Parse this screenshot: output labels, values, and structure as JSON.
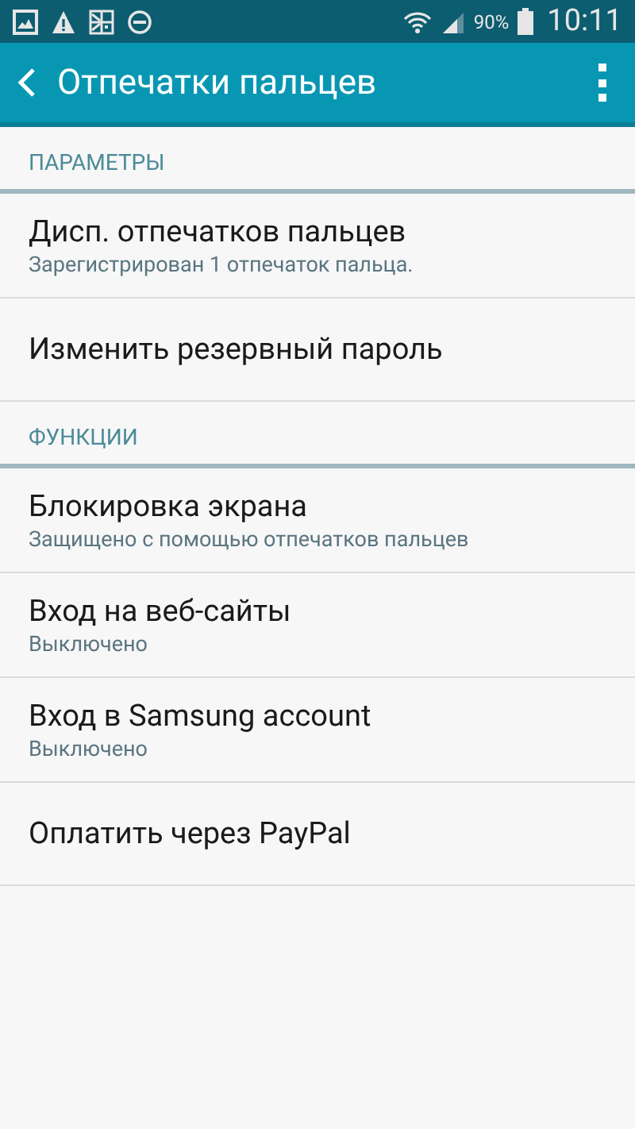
{
  "status_bar": {
    "battery_text": "90%",
    "time": "10:11"
  },
  "app_bar": {
    "title": "Отпечатки пальцев"
  },
  "sections": [
    {
      "header": "ПАРАМЕТРЫ",
      "items": [
        {
          "title": "Дисп. отпечатков пальцев",
          "subtitle": "Зарегистрирован 1 отпечаток пальца."
        },
        {
          "title": "Изменить резервный пароль"
        }
      ]
    },
    {
      "header": "ФУНКЦИИ",
      "items": [
        {
          "title": "Блокировка экрана",
          "subtitle": "Защищено с помощью отпечатков пальцев"
        },
        {
          "title": "Вход на веб-сайты",
          "subtitle": "Выключено"
        },
        {
          "title": "Вход в Samsung account",
          "subtitle": "Выключено"
        },
        {
          "title": "Оплатить через PayPal"
        }
      ]
    }
  ]
}
